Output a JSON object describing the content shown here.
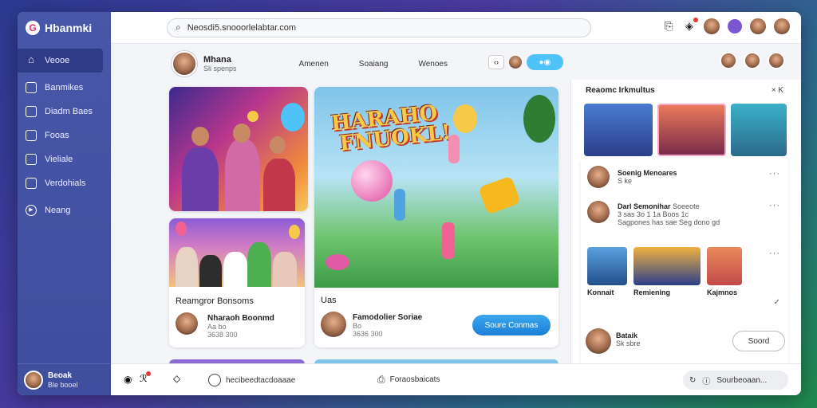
{
  "app": {
    "brand": "Hbanmki"
  },
  "search": {
    "text": "Neosdi5.snooorlelabtar.com"
  },
  "sidebar": {
    "items": [
      {
        "label": "Veooe",
        "icon": "home-icon"
      },
      {
        "label": "Banmikes",
        "icon": "list-icon"
      },
      {
        "label": "Diadm Baes",
        "icon": "folder-icon"
      },
      {
        "label": "Fooas",
        "icon": "folder-icon"
      },
      {
        "label": "Vieliale",
        "icon": "square-icon"
      },
      {
        "label": "Verdohials",
        "icon": "message-icon"
      },
      {
        "label": "Neang",
        "icon": "play-icon"
      }
    ],
    "user": {
      "name": "Beoak",
      "sub": "Ble booel"
    }
  },
  "profile": {
    "name": "Mhana",
    "sub": "Sli spenps",
    "tabs": [
      "Amenen",
      "Soaiang",
      "Wenoes"
    ]
  },
  "cards": {
    "left_bottom": {
      "title": "Reamgror Bonsoms",
      "name": "Nharaoh Boonmd",
      "meta1": "Aa bo",
      "meta2": "3638 300"
    },
    "center": {
      "poster_line1": "HARAHO",
      "poster_line2": "FNUOKL!",
      "title": "Uas",
      "name": "Famodolier Soriae",
      "meta1": "Bo",
      "meta2": "3636 300",
      "button": "Soure Conmas"
    }
  },
  "right_panel": {
    "title": "Reaomc Irkmultus",
    "close": "× K",
    "rows": [
      {
        "name": "Soenig Menoares",
        "meta": "S ke"
      },
      {
        "name": "Darl Semonihar",
        "extra": "Soeeote",
        "meta1": "3 sas 3o 1 1a Boos 1c",
        "meta2": "Sagpones has sae Seg dono gd"
      }
    ],
    "thumb_labels": [
      "Konnait",
      "Remiening",
      "Kajmnos"
    ],
    "footer": {
      "name": "Bataik",
      "meta": "Sk sbre",
      "button": "Soord"
    }
  },
  "bottombar": {
    "link": "hecibeedtacdoaaae",
    "center": "Foraosbaicats",
    "pill": "Sourbeoaan..."
  }
}
